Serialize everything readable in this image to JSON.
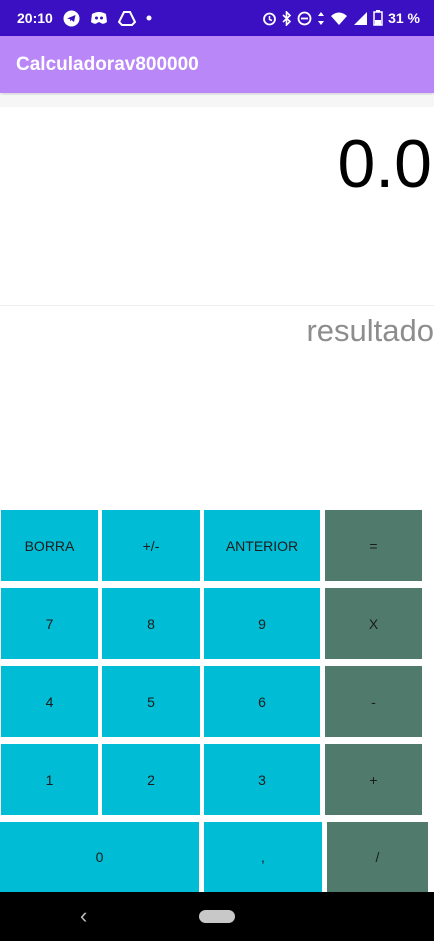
{
  "status_bar": {
    "time": "20:10",
    "battery": "31 %",
    "left_icons": [
      "telegram-icon",
      "discord-icon",
      "drive-icon",
      "dot-icon"
    ],
    "right_icons": [
      "alarm-icon",
      "bluetooth-icon",
      "do-not-disturb-icon",
      "data-arrows-icon",
      "wifi-icon",
      "signal-icon",
      "battery-icon"
    ]
  },
  "app_bar": {
    "title": "Calculadorav800000"
  },
  "display": {
    "value": "0.0"
  },
  "result": {
    "placeholder": "resultado"
  },
  "keypad": {
    "borra": "BORRA",
    "sign": "+/-",
    "anterior": "ANTERIOR",
    "equals": "=",
    "seven": "7",
    "eight": "8",
    "nine": "9",
    "multiply": "X",
    "four": "4",
    "five": "5",
    "six": "6",
    "minus": "-",
    "one": "1",
    "two": "2",
    "three": "3",
    "plus": "+",
    "zero": "0",
    "comma": ",",
    "divide": "/"
  },
  "colors": {
    "status_bar": "#3b0fc2",
    "app_bar": "#b987f7",
    "number_key": "#00bcd4",
    "operator_key": "#4f7a6c"
  }
}
